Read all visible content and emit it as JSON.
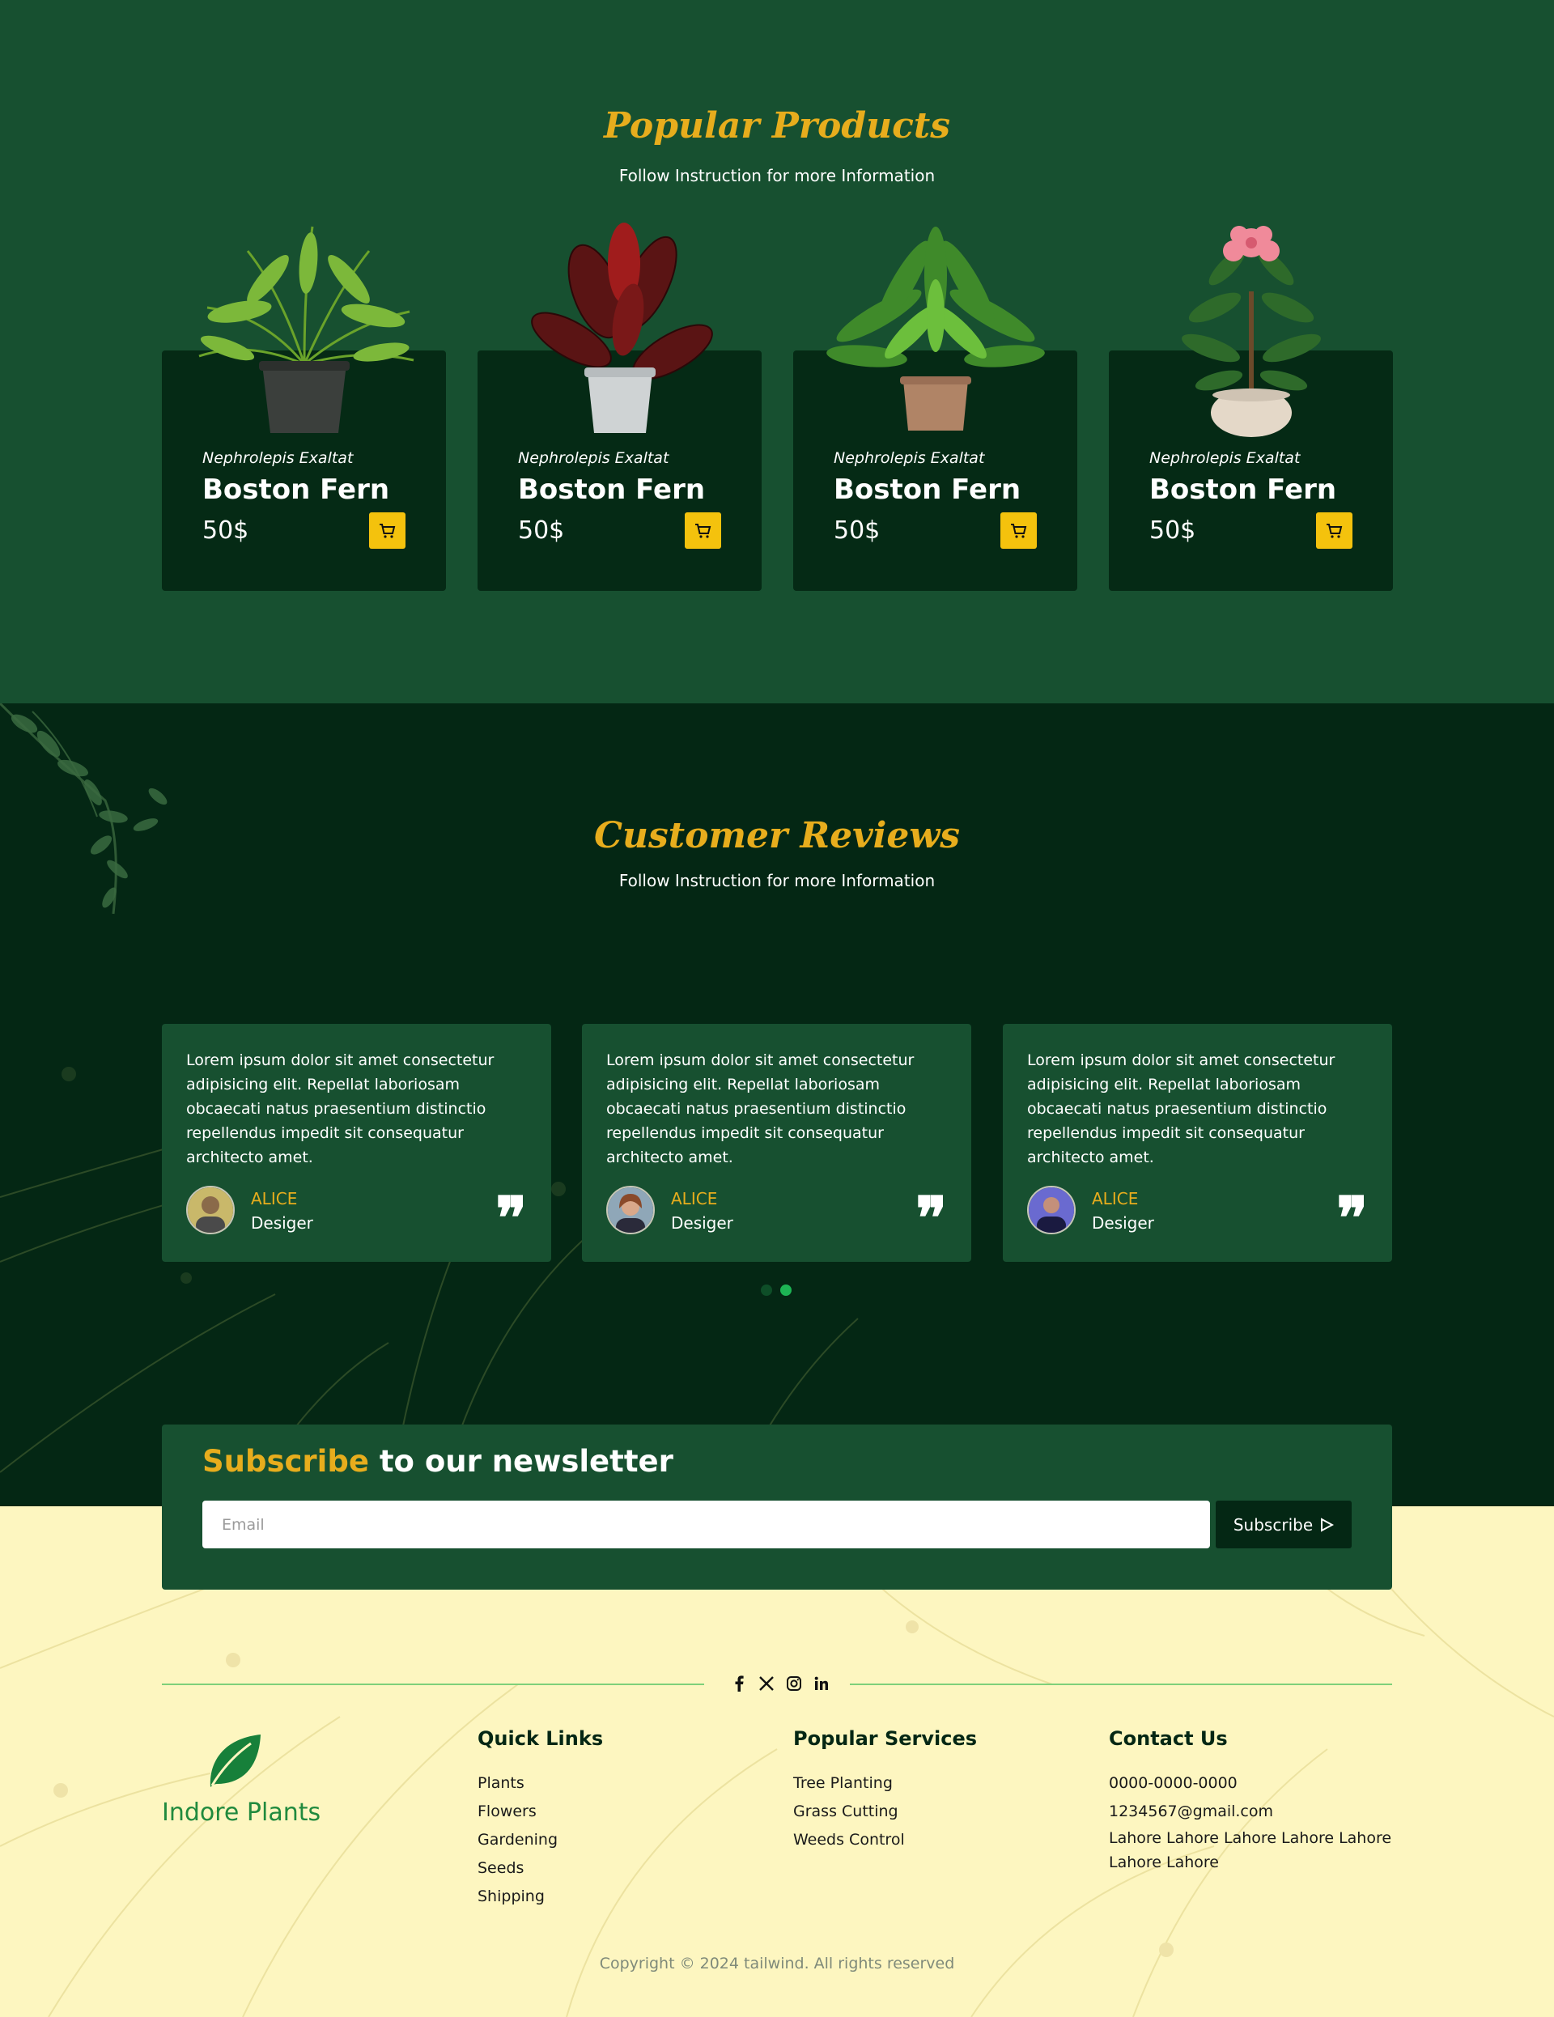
{
  "products": {
    "title": "Popular Products",
    "subtitle": "Follow Instruction for more Information",
    "items": [
      {
        "scientific": "Nephrolepis Exaltat",
        "name": "Boston Fern",
        "price": "50$",
        "image": "boston-fern-plant"
      },
      {
        "scientific": "Nephrolepis Exaltat",
        "name": "Boston Fern",
        "price": "50$",
        "image": "rubber-plant"
      },
      {
        "scientific": "Nephrolepis Exaltat",
        "name": "Boston Fern",
        "price": "50$",
        "image": "leafy-green-plant"
      },
      {
        "scientific": "Nephrolepis Exaltat",
        "name": "Boston Fern",
        "price": "50$",
        "image": "pink-flower-plant"
      }
    ],
    "cart_icon": "cart-icon"
  },
  "reviews": {
    "title": "Customer Reviews",
    "subtitle": "Follow Instruction for more Information",
    "items": [
      {
        "text": "Lorem ipsum dolor sit amet consectetur adipisicing elit. Repellat laboriosam obcaecati natus praesentium distinctio repellendus impedit sit consequatur architecto amet.",
        "name": "ALICE",
        "role": "Desiger"
      },
      {
        "text": "Lorem ipsum dolor sit amet consectetur adipisicing elit. Repellat laboriosam obcaecati natus praesentium distinctio repellendus impedit sit consequatur architecto amet.",
        "name": "ALICE",
        "role": "Desiger"
      },
      {
        "text": "Lorem ipsum dolor sit amet consectetur adipisicing elit. Repellat laboriosam obcaecati natus praesentium distinctio repellendus impedit sit consequatur architecto amet.",
        "name": "ALICE",
        "role": "Desiger"
      }
    ],
    "quote_mark": "❞",
    "active_dot": 2,
    "dot_count": 2
  },
  "newsletter": {
    "title_highlight": "Subscribe",
    "title_rest": " to our newsletter",
    "email_placeholder": "Email",
    "button_label": "Subscribe"
  },
  "footer": {
    "brand": "Indore Plants",
    "quick_links": {
      "title": "Quick Links",
      "items": [
        "Plants",
        "Flowers",
        "Gardening",
        "Seeds",
        "Shipping"
      ]
    },
    "services": {
      "title": "Popular Services",
      "items": [
        "Tree Planting",
        "Grass Cutting",
        "Weeds Control"
      ]
    },
    "contact": {
      "title": "Contact Us",
      "phone": "0000-0000-0000",
      "email": "1234567@gmail.com",
      "address": "Lahore Lahore Lahore Lahore Lahore Lahore Lahore"
    },
    "socials": [
      "facebook-icon",
      "x-icon",
      "instagram-icon",
      "linkedin-icon"
    ],
    "copyright": "Copyright © 2024 tailwind. All rights reserved"
  },
  "colors": {
    "dark_green": "#042714",
    "mid_green": "#175030",
    "accent_yellow": "#e7ad1d",
    "cart_yellow": "#f4c20d",
    "cream": "#fdf6c0"
  }
}
